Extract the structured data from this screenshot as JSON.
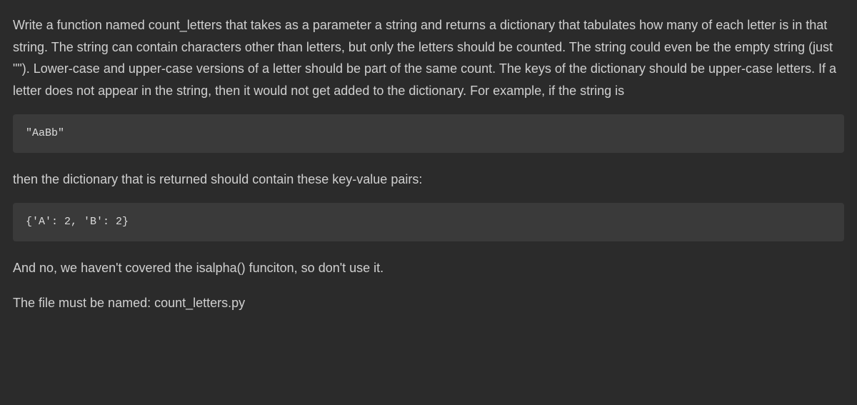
{
  "content": {
    "paragraph1": "Write a function named count_letters that takes as a parameter a string and returns a dictionary that tabulates how many of each letter is in that string. The string can contain characters other than letters, but only the letters should be counted. The string could even be the empty string (just \"\"). Lower-case and upper-case versions of a letter should be part of the same count. The keys of the dictionary should be upper-case letters. If a letter does not appear in the string, then it would not get added to the dictionary. For example, if the string is",
    "code1": "\"AaBb\"",
    "paragraph2": "then the dictionary that is returned should contain these key-value pairs:",
    "code2": "{'A': 2, 'B': 2}",
    "paragraph3": "And no, we haven't covered the isalpha() funciton, so don't use it.",
    "paragraph4": "The file must be named: count_letters.py"
  }
}
